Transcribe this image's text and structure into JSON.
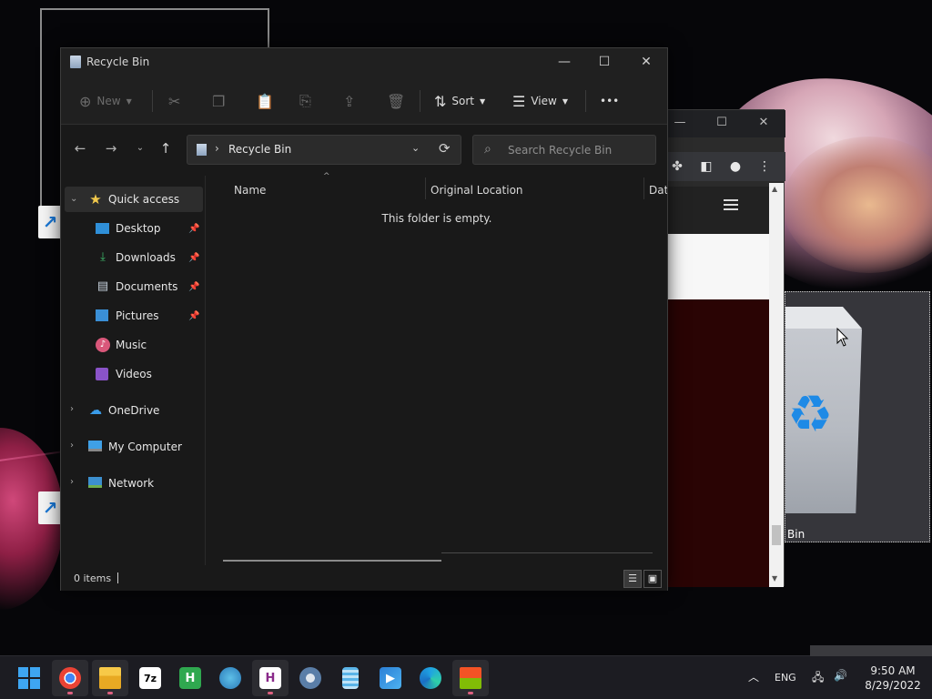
{
  "explorer": {
    "title": "Recycle Bin",
    "window_controls": {
      "minimize": "—",
      "maximize": "☐",
      "close": "✕"
    },
    "commands": {
      "new_label": "New",
      "sort_label": "Sort",
      "view_label": "View",
      "more_label": "•••"
    },
    "address": {
      "path": "Recycle Bin"
    },
    "search": {
      "placeholder": "Search Recycle Bin"
    },
    "nav": {
      "quick_access": "Quick access",
      "items": [
        {
          "label": "Desktop",
          "icon": "desktop-icon",
          "pinned": true
        },
        {
          "label": "Downloads",
          "icon": "download-icon",
          "pinned": true
        },
        {
          "label": "Documents",
          "icon": "documents-icon",
          "pinned": true
        },
        {
          "label": "Pictures",
          "icon": "pictures-icon",
          "pinned": true
        },
        {
          "label": "Music",
          "icon": "music-icon",
          "pinned": false
        },
        {
          "label": "Videos",
          "icon": "videos-icon",
          "pinned": false
        }
      ],
      "onedrive": "OneDrive",
      "my_computer": "My Computer",
      "network": "Network"
    },
    "columns": [
      "Name",
      "Original Location",
      "Date"
    ],
    "empty_message": "This folder is empty.",
    "status": {
      "item_count": "0 items"
    }
  },
  "desktop": {
    "recycle_bin_label": "Bin"
  },
  "taskbar": {
    "apps": [
      {
        "name": "start",
        "icon": "windows-start-icon"
      },
      {
        "name": "chrome",
        "icon": "chrome-icon",
        "running": true
      },
      {
        "name": "file-explorer",
        "icon": "folder-icon",
        "running": true
      },
      {
        "name": "7zip",
        "icon": "7zip-icon",
        "label": "7z"
      },
      {
        "name": "h-app",
        "icon": "h-app-icon",
        "label": "H"
      },
      {
        "name": "globe-app",
        "icon": "globe-icon"
      },
      {
        "name": "h-app-2",
        "icon": "h-app-2-icon",
        "label": "H",
        "running": true
      },
      {
        "name": "settings",
        "icon": "settings-icon"
      },
      {
        "name": "notepad",
        "icon": "notepad-icon"
      },
      {
        "name": "media",
        "icon": "media-icon"
      },
      {
        "name": "edge",
        "icon": "edge-icon"
      },
      {
        "name": "store",
        "icon": "store-icon",
        "running": true
      }
    ],
    "tray": {
      "language": "ENG",
      "time": "9:50 AM",
      "date": "8/29/2022"
    }
  },
  "colors": {
    "accent_blue": "#3ea6f2",
    "quick_access_star": "#f2c94c",
    "running_indicator": "#e06080"
  }
}
